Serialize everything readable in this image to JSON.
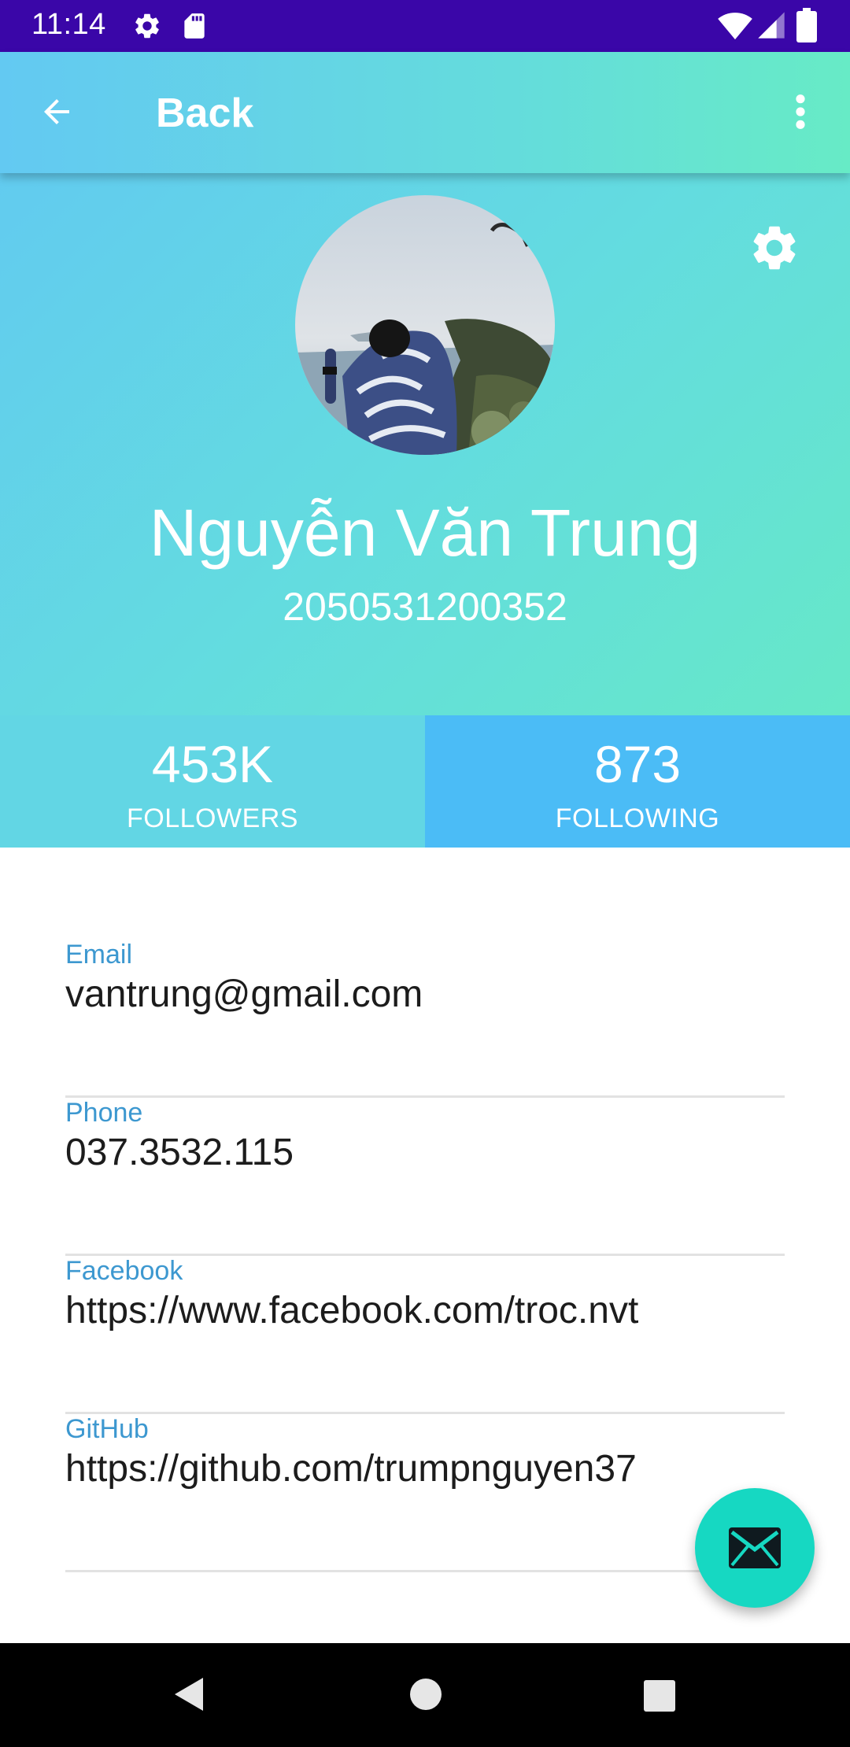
{
  "status_bar": {
    "time": "11:14",
    "icons": [
      "settings-icon",
      "sd-card-icon",
      "wifi-icon",
      "signal-icon",
      "battery-icon"
    ]
  },
  "toolbar": {
    "title": "Back",
    "back_icon": "arrow-back-icon",
    "menu_icon": "more-vert-icon"
  },
  "profile": {
    "name": "Nguyễn Văn Trung",
    "id": "2050531200352",
    "settings_icon": "gear-icon"
  },
  "stats": [
    {
      "count": "453K",
      "label": "FOLLOWERS"
    },
    {
      "count": "873",
      "label": "FOLLOWING"
    }
  ],
  "info": [
    {
      "label": "Email",
      "value": "vantrung@gmail.com"
    },
    {
      "label": "Phone",
      "value": "037.3532.115"
    },
    {
      "label": "Facebook",
      "value": "https://www.facebook.com/troc.nvt"
    },
    {
      "label": "GitHub",
      "value": "https://github.com/trumpnguyen37"
    }
  ],
  "fab": {
    "icon": "mail-icon"
  },
  "nav_bar": {
    "icons": [
      "nav-back-icon",
      "nav-home-icon",
      "nav-recents-icon"
    ]
  },
  "colors": {
    "status_bar": "#3a06a8",
    "gradient_start": "#62c8f2",
    "gradient_end": "#66e8c8",
    "followers_bg": "#62d6e4",
    "following_bg": "#4bbcf6",
    "label_blue": "#3d98d0",
    "fab": "#16d8c2"
  }
}
